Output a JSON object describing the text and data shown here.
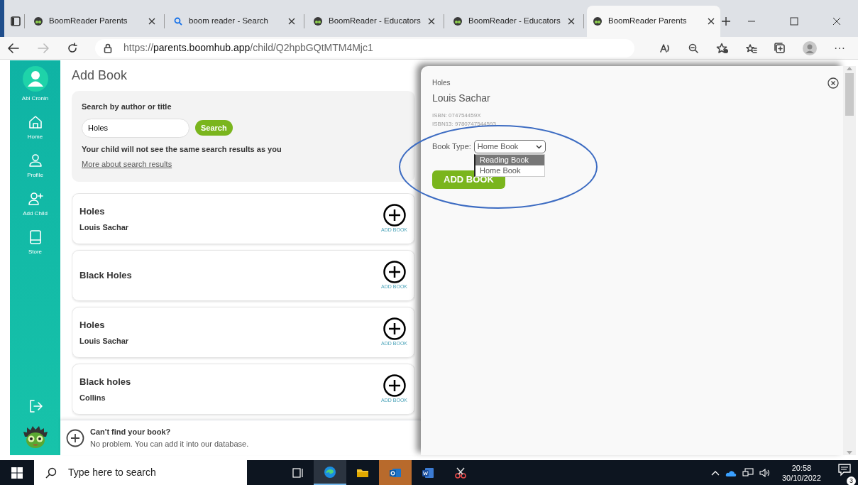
{
  "browser": {
    "tabs": [
      {
        "title": "BoomReader Parents",
        "kind": "boom",
        "selected": false
      },
      {
        "title": "boom reader - Search",
        "kind": "search",
        "selected": false
      },
      {
        "title": "BoomReader - Educators",
        "kind": "boom",
        "selected": false
      },
      {
        "title": "BoomReader - Educators",
        "kind": "boom",
        "selected": false
      },
      {
        "title": "BoomReader Parents",
        "kind": "boom",
        "selected": true
      }
    ],
    "url": {
      "scheme": "https://",
      "host": "parents.boomhub.app",
      "path": "/child/Q2hpbGQtMTM4Mjc1"
    },
    "forward_disabled": true,
    "more": "···"
  },
  "sidebar": {
    "user": "Abi Cronin",
    "items": [
      {
        "label": "Home",
        "kind": "home"
      },
      {
        "label": "Profile",
        "kind": "profile"
      },
      {
        "label": "Add Child",
        "kind": "add-child"
      },
      {
        "label": "Store",
        "kind": "store"
      }
    ]
  },
  "page": {
    "title": "Add Book",
    "search": {
      "label": "Search by author or title",
      "value": "Holes",
      "button": "Search",
      "note": "Your child will not see the same search results as you",
      "link": "More about search results"
    },
    "results": [
      {
        "title": "Holes",
        "author": "Louis Sachar",
        "action": "ADD BOOK"
      },
      {
        "title": "Black Holes",
        "action": "ADD BOOK"
      },
      {
        "title": "Holes",
        "author": "Louis Sachar",
        "action": "ADD BOOK"
      },
      {
        "title": "Black holes",
        "author": "Collins",
        "action": "ADD BOOK"
      }
    ],
    "footer": {
      "title": "Can't find your book?",
      "text": "No problem. You can add it into our database."
    }
  },
  "detail": {
    "title": "Holes",
    "author": "Louis Sachar",
    "isbn": "ISBN: 074754459X",
    "isbn13": "ISBN13: 9780747544593",
    "book_type": {
      "label": "Book Type:",
      "value": "Home Book",
      "expanded": true,
      "options": [
        {
          "label": "Reading Book",
          "highlighted": true
        },
        {
          "label": "Home Book",
          "highlighted": false
        }
      ]
    },
    "button": "ADD BOOK"
  },
  "taskbar": {
    "search_placeholder": "Type here to search",
    "apps": [
      {
        "kind": "taskview"
      },
      {
        "kind": "edge",
        "selected": true,
        "attention": false
      },
      {
        "kind": "explorer",
        "selected": false,
        "attention": false
      },
      {
        "kind": "outlook",
        "selected": false,
        "attention": true
      },
      {
        "kind": "word",
        "selected": false,
        "attention": false
      },
      {
        "kind": "snip",
        "selected": false,
        "attention": false
      }
    ],
    "time": "20:58",
    "date": "30/10/2022",
    "notifications": "3"
  }
}
